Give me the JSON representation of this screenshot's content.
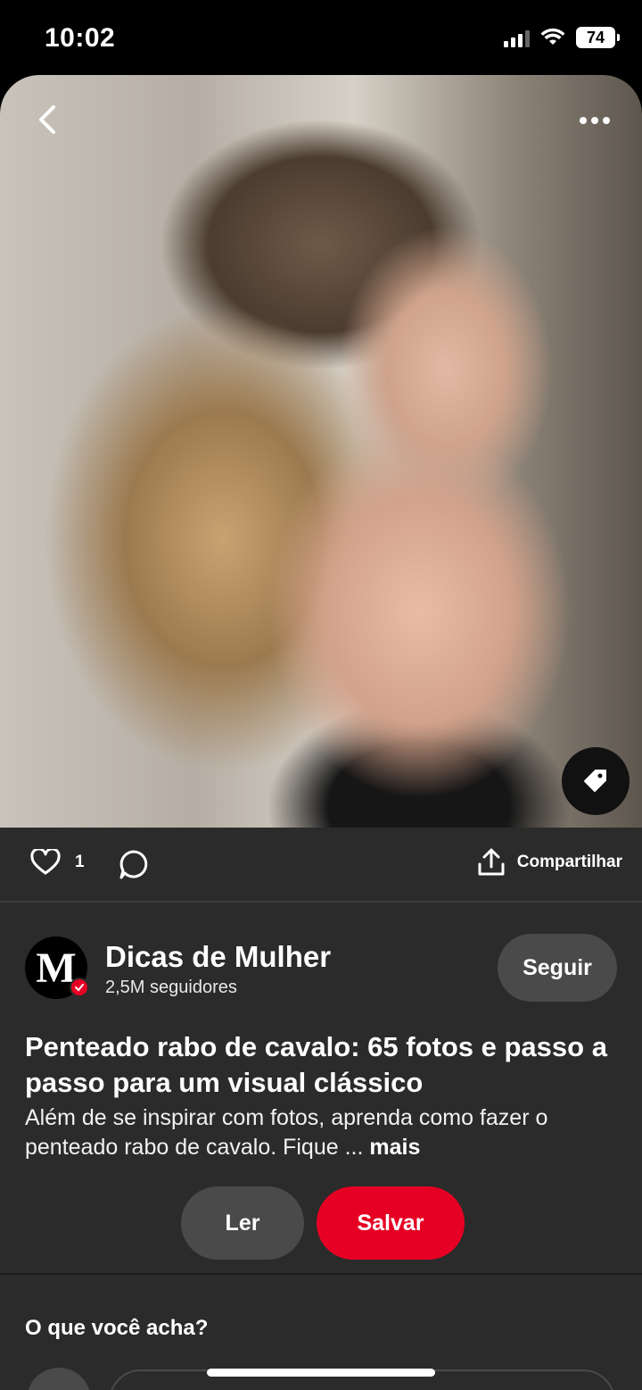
{
  "status_bar": {
    "time": "10:02",
    "battery": "74"
  },
  "pin": {
    "image_description_icon": "photo",
    "back_icon": "chevron-left-icon",
    "more_icon": "more-horizontal-icon",
    "tag_icon": "tag-icon"
  },
  "actions": {
    "like_count": "1",
    "share_label": "Compartilhar"
  },
  "creator": {
    "avatar_letter": "M",
    "name": "Dicas de Mulher",
    "followers": "2,5M seguidores",
    "follow_label": "Seguir"
  },
  "details": {
    "title": "Penteado rabo de cavalo: 65 fotos e passo a passo para um visual clássico",
    "description": "Além de se inspirar com fotos, aprenda como fazer o penteado rabo de cavalo. Fique ...",
    "more_label": "mais",
    "read_label": "Ler",
    "save_label": "Salvar"
  },
  "comments": {
    "heading": "O que você acha?"
  },
  "colors": {
    "accent": "#e60023",
    "surface": "#2b2b2b",
    "button_gray": "#4a4a4a"
  }
}
